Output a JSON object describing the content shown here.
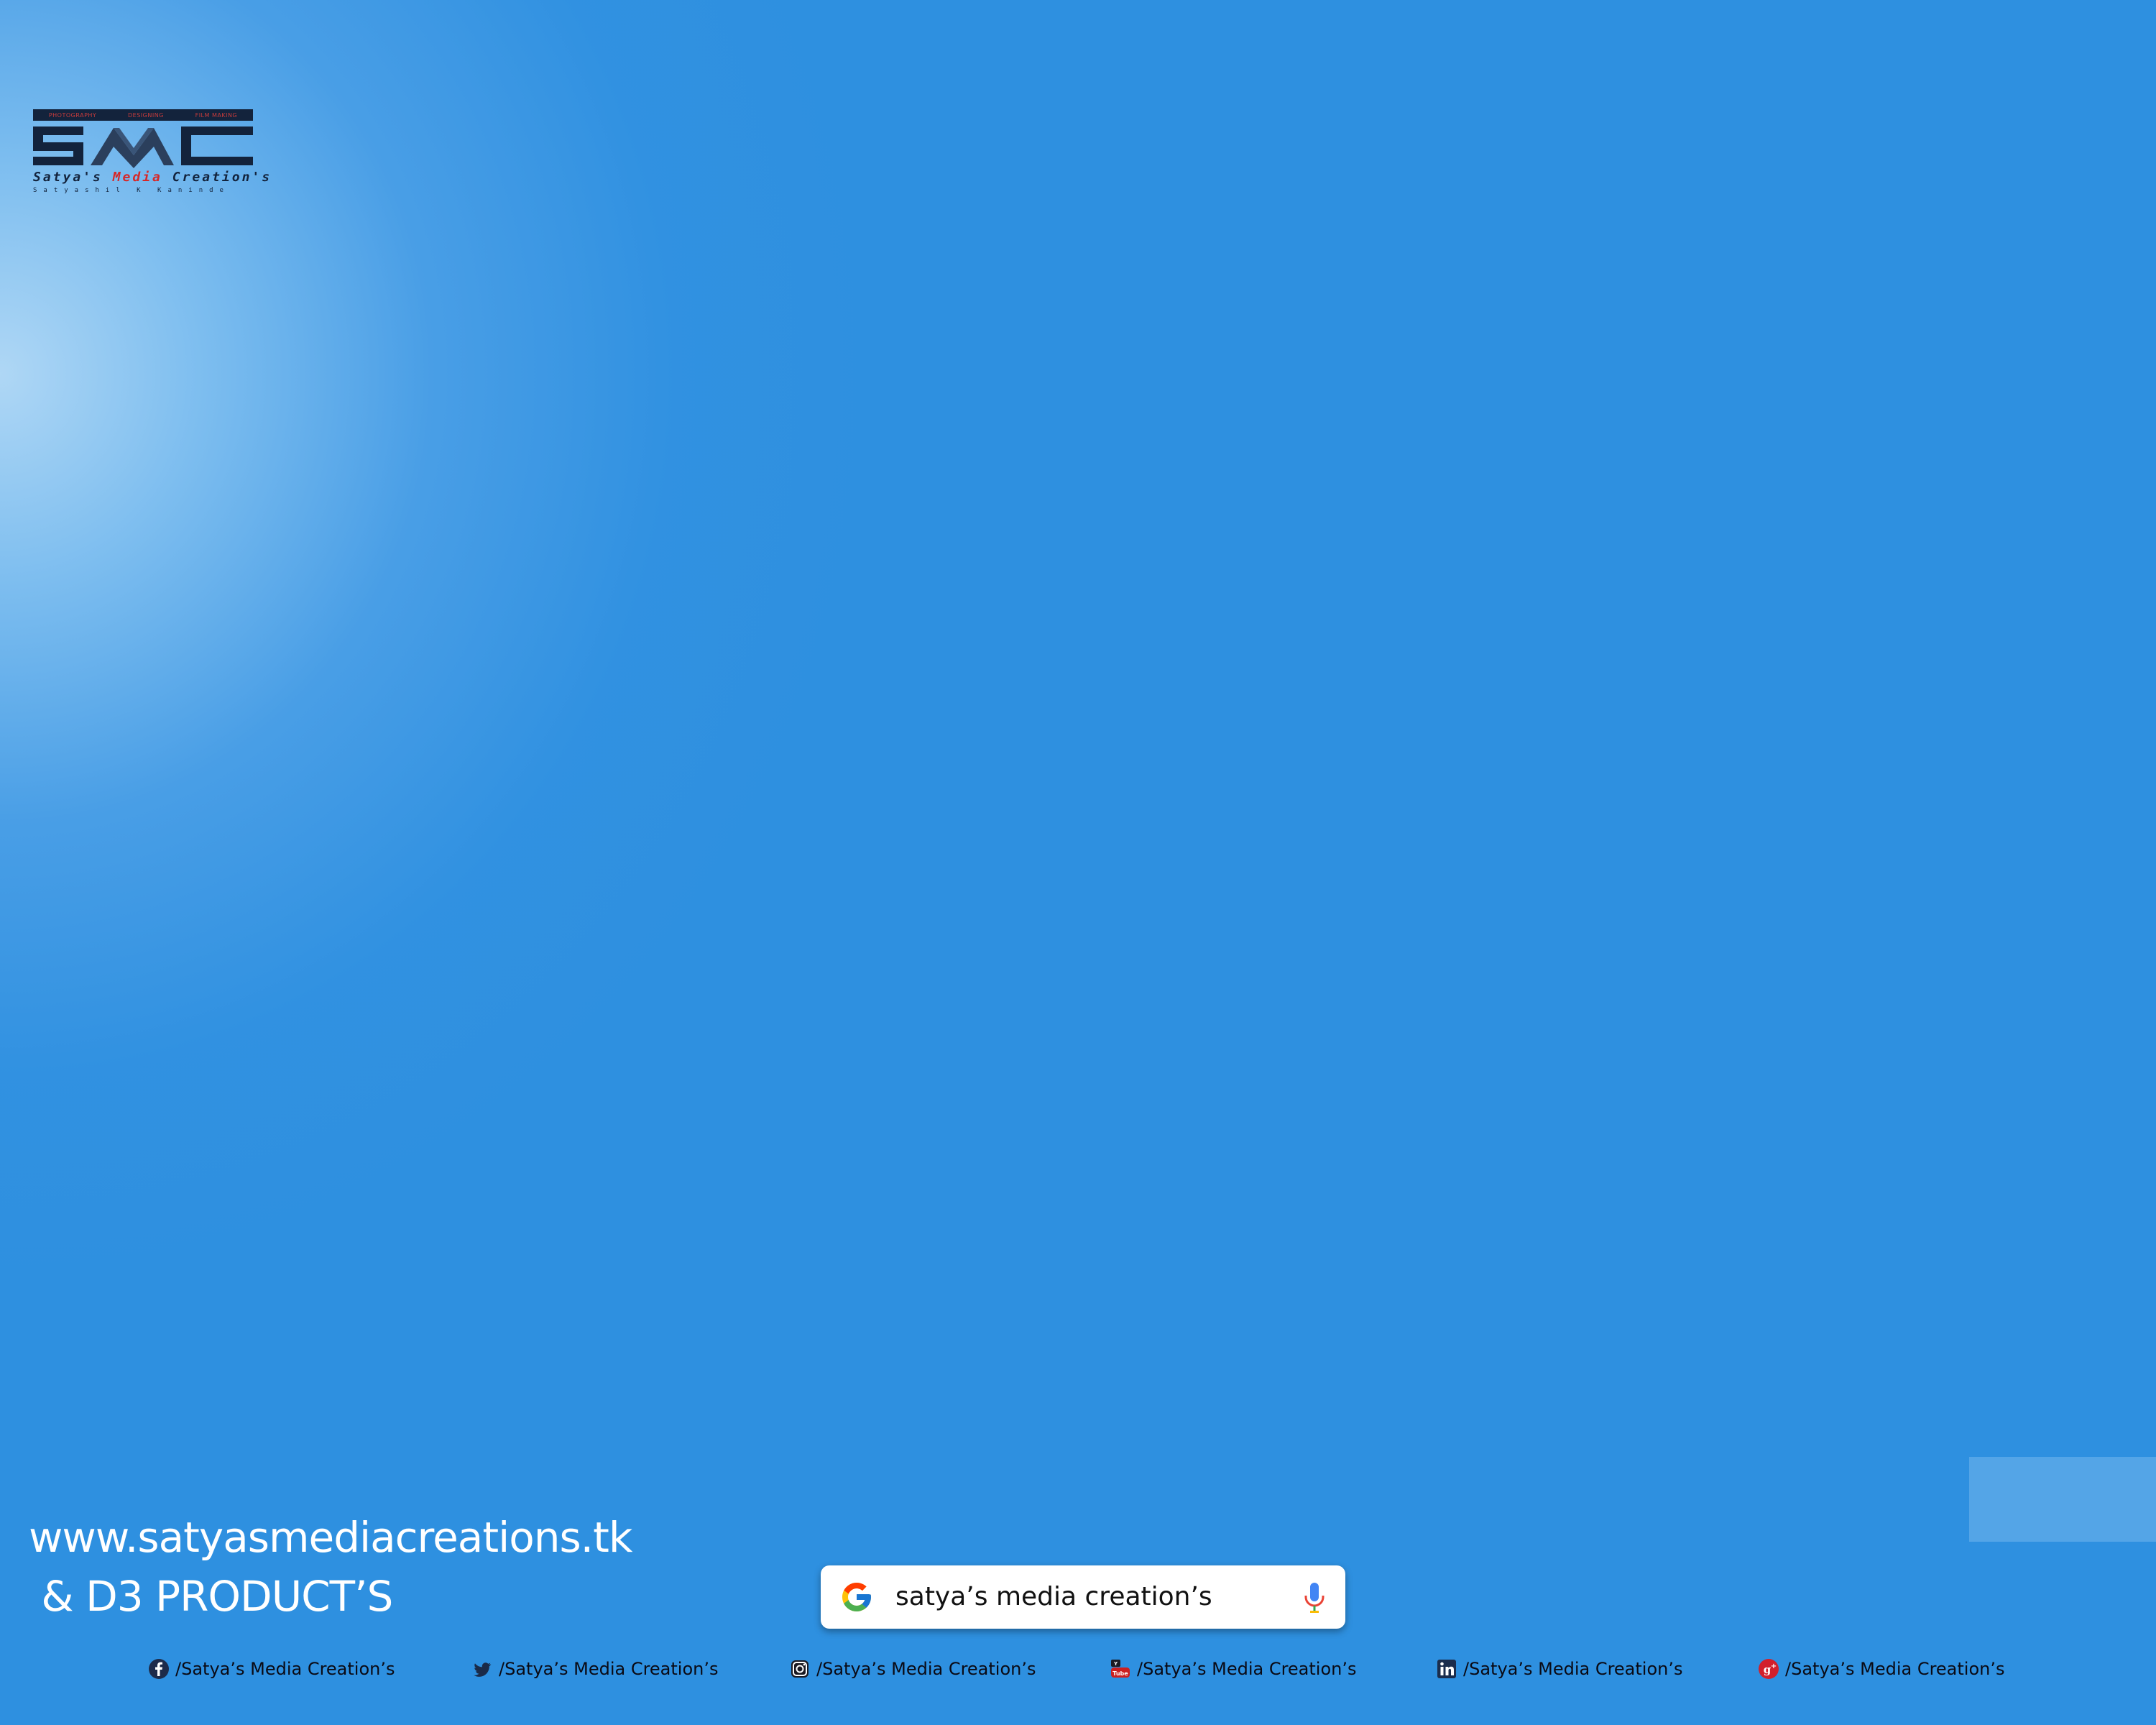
{
  "logo": {
    "topbar": [
      "PHOTOGRAPHY",
      "DESIGNING",
      "FILM MAKING"
    ],
    "mark": "SMC",
    "name_part1": "Satya's ",
    "name_part2": "Media",
    "name_part3": " Creation's",
    "subtitle": "Satyashil K Kaninde"
  },
  "website": {
    "url": "www.satyasmediacreations.tk",
    "line2": " & D3 PRODUCT’S"
  },
  "search": {
    "query": "satya’s media creation’s",
    "icon": "google-g-icon",
    "mic_icon": "microphone-icon"
  },
  "social": [
    {
      "icon": "facebook-icon",
      "label": "/Satya’s Media Creation’s"
    },
    {
      "icon": "twitter-icon",
      "label": "/Satya’s Media Creation’s"
    },
    {
      "icon": "instagram-icon",
      "label": "/Satya’s Media Creation’s"
    },
    {
      "icon": "youtube-icon",
      "label": "/Satya’s Media Creation’s"
    },
    {
      "icon": "linkedin-icon",
      "label": "/Satya’s Media Creation’s"
    },
    {
      "icon": "google-plus-icon",
      "label": "/Satya’s Media Creation’s"
    }
  ],
  "colors": {
    "background": "#2e90e0",
    "logo_navy": "#13233c",
    "logo_red": "#d62828"
  }
}
